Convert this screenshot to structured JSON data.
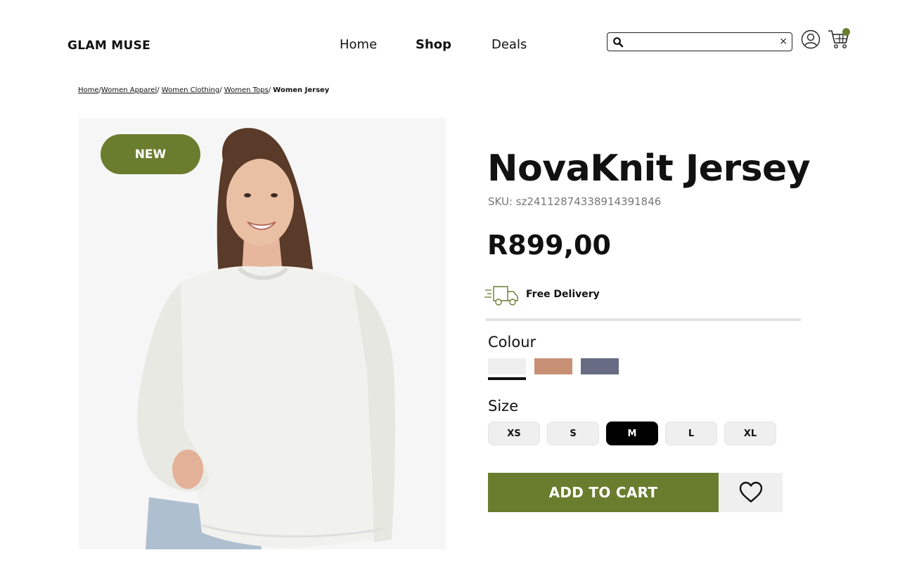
{
  "brand": {
    "name": "GLAM MUSE"
  },
  "nav": {
    "home": "Home",
    "shop": "Shop",
    "deals": "Deals"
  },
  "search": {
    "value": "",
    "placeholder": "",
    "clear_label": "×"
  },
  "header_icons": {
    "user": "user-icon",
    "cart": "cart-icon"
  },
  "breadcrumb": {
    "items": [
      "Home",
      "Women Apparel",
      "Women Clothing",
      "Women Tops"
    ],
    "current": "Women Jersey",
    "separator": "/"
  },
  "product": {
    "badge": "NEW",
    "name": "NovaKnit Jersey",
    "sku": "SKU: sz24112874338914391846",
    "price": "R899,00",
    "delivery": "Free Delivery",
    "colour_label": "Colour",
    "colours": [
      "#efefef",
      "#c89176",
      "#676c84"
    ],
    "selected_colour_index": 0,
    "size_label": "Size",
    "sizes": [
      "XS",
      "S",
      "M",
      "L",
      "XL"
    ],
    "selected_size": "M",
    "add_to_cart": "ADD TO CART"
  },
  "colors": {
    "accent": "#6a7d2e",
    "text": "#111111",
    "muted": "#777777"
  }
}
